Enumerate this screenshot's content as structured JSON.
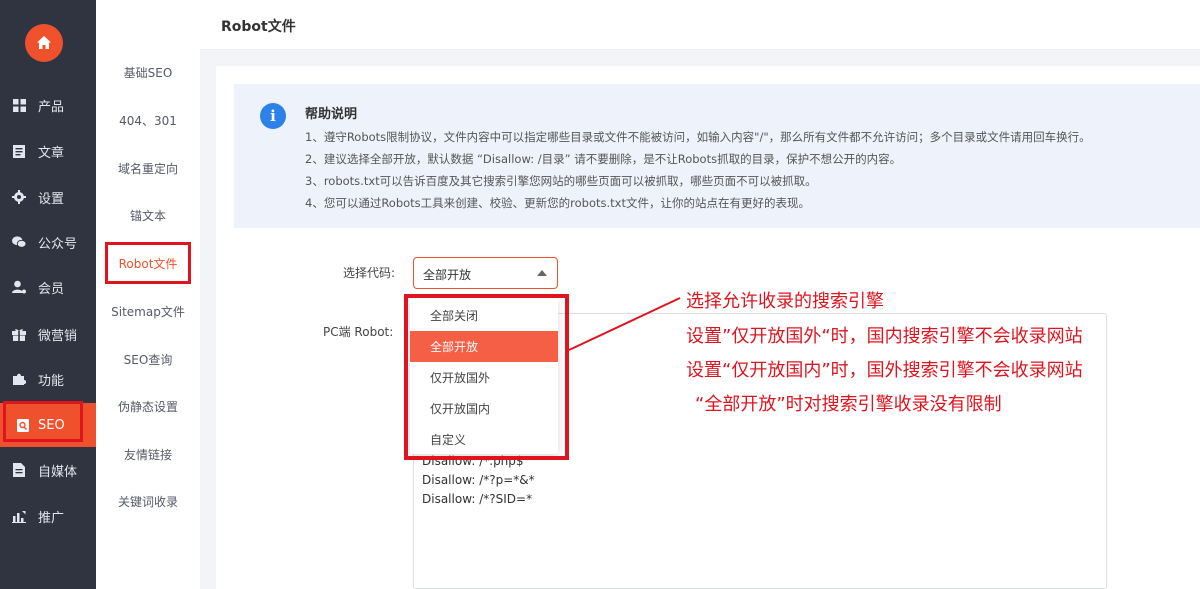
{
  "sidebar": {
    "items": [
      {
        "label": "产品",
        "icon": "grid-icon"
      },
      {
        "label": "文章",
        "icon": "document-icon"
      },
      {
        "label": "设置",
        "icon": "gear-icon"
      },
      {
        "label": "公众号",
        "icon": "wechat-icon"
      },
      {
        "label": "会员",
        "icon": "user-icon"
      },
      {
        "label": "微营销",
        "icon": "gift-icon"
      },
      {
        "label": "功能",
        "icon": "puzzle-icon"
      },
      {
        "label": "SEO",
        "icon": "seo-icon"
      },
      {
        "label": "自媒体",
        "icon": "file-icon"
      },
      {
        "label": "推广",
        "icon": "chart-icon"
      }
    ],
    "active": "SEO"
  },
  "submenu": {
    "items": [
      "基础SEO",
      "404、301",
      "域名重定向",
      "锚文本",
      "Robot文件",
      "Sitemap文件",
      "SEO查询",
      "伪静态设置",
      "友情链接",
      "关键词收录"
    ],
    "active": "Robot文件"
  },
  "page": {
    "title": "Robot文件"
  },
  "help": {
    "title": "帮助说明",
    "lines": [
      "1、遵守Robots限制协议，文件内容中可以指定哪些目录或文件不能被访问，如输入内容\"/\"，那么所有文件都不允许访问；多个目录或文件请用回车换行。",
      "2、建议选择全部开放，默认数据 “Disallow: /目录” 请不要删除，是不让Robots抓取的目录，保护不想公开的内容。",
      "3、robots.txt可以告诉百度及其它搜索引擎您网站的哪些页面可以被抓取，哪些页面不可以被抓取。",
      "4、您可以通过Robots工具来创建、校验、更新您的robots.txt文件，让你的站点在有更好的表现。"
    ]
  },
  "form": {
    "select_label": "选择代码:",
    "selected": "全部开放",
    "options": [
      "全部关闭",
      "全部开放",
      "仅开放国外",
      "仅开放国内",
      "自定义"
    ],
    "pc_robot_label": "PC端 Robot:",
    "robot_lines": [
      "Disallow: /*.php$",
      "Disallow: /*?p=*&*",
      "Disallow: /*?SID=*"
    ]
  },
  "annotation": {
    "lines": [
      "选择允许收录的搜索引擎",
      "设置”仅开放国外“时，国内搜索引擎不会收录网站",
      "设置“仅开放国内”时，国外搜索引擎不会收录网站",
      "“全部开放”时对搜索引擎收录没有限制"
    ],
    "color": "#e0141e"
  },
  "colors": {
    "accent": "#f0512d",
    "sidebar_bg": "#2f3440",
    "highlight": "#e0141e",
    "info": "#2c82e8"
  }
}
